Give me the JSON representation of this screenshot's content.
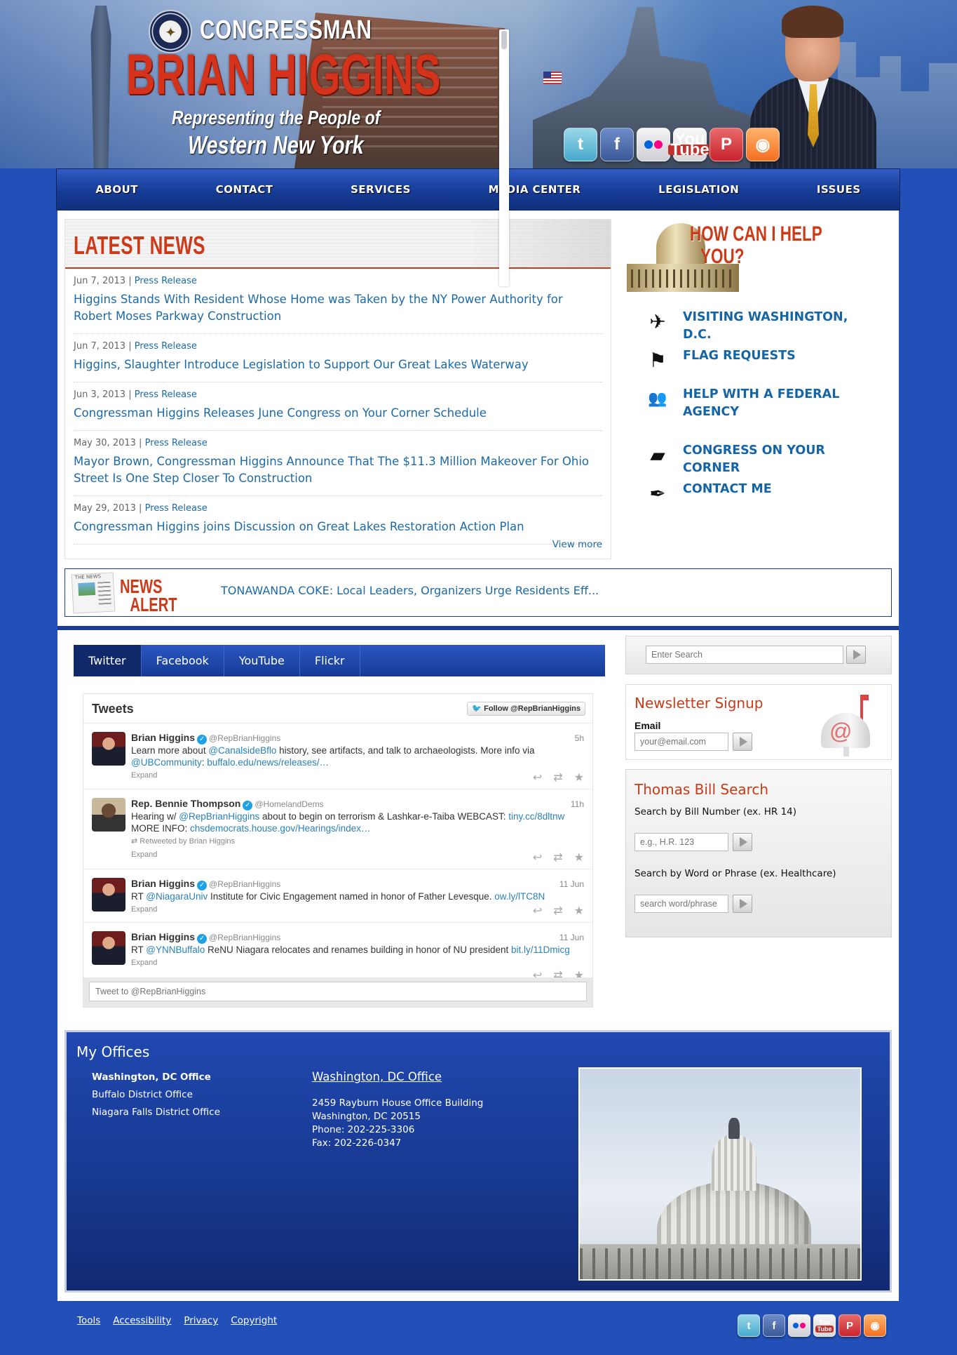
{
  "header": {
    "congressman": "CONGRESSMAN",
    "name": "BRIAN HIGGINS",
    "tagline_1": "Representing the People of",
    "tagline_2": "Western New York",
    "social": [
      "twitter-icon",
      "facebook-icon",
      "flickr-icon",
      "youtube-icon",
      "pinterest-icon",
      "rss-icon"
    ]
  },
  "nav": [
    "ABOUT",
    "CONTACT",
    "SERVICES",
    "MEDIA CENTER",
    "LEGISLATION",
    "ISSUES"
  ],
  "news": {
    "heading": "LATEST NEWS",
    "items": [
      {
        "date": "Jun 7, 2013",
        "sep": "|",
        "category": "Press Release",
        "title": "Higgins Stands With Resident Whose Home was Taken by the NY Power Authority for Robert Moses Parkway Construction"
      },
      {
        "date": "Jun 7, 2013",
        "sep": "|",
        "category": "Press Release",
        "title": "Higgins, Slaughter Introduce Legislation to Support Our Great Lakes Waterway"
      },
      {
        "date": "Jun 3, 2013",
        "sep": "|",
        "category": "Press Release",
        "title": "Congressman Higgins Releases June Congress on Your Corner Schedule"
      },
      {
        "date": "May 30, 2013",
        "sep": "|",
        "category": "Press Release",
        "title": "Mayor Brown, Congressman Higgins Announce That The $11.3 Million Makeover For Ohio Street Is One Step Closer To Construction"
      },
      {
        "date": "May 29, 2013",
        "sep": "|",
        "category": "Press Release",
        "title": "Congressman Higgins joins Discussion on Great Lakes Restoration Action Plan"
      }
    ],
    "view_more": "View more"
  },
  "help": {
    "title_1": "HOW CAN I HELP",
    "title_2": "YOU?",
    "items": [
      {
        "label": "VISITING WASHINGTON, D.C.",
        "icon": "airplane-icon",
        "glyph": "✈"
      },
      {
        "label": "FLAG REQUESTS",
        "icon": "flag-icon",
        "glyph": "⚑"
      },
      {
        "label": "HELP WITH A FEDERAL AGENCY",
        "icon": "people-icon",
        "glyph": "👥"
      },
      {
        "label": "CONGRESS ON YOUR CORNER",
        "icon": "usa-map-icon",
        "glyph": "▰"
      },
      {
        "label": "CONTACT ME",
        "icon": "pen-icon",
        "glyph": "✒"
      }
    ]
  },
  "alert": {
    "label_1": "NEWS",
    "label_2": "ALERT",
    "paper_text": "THE NEWS",
    "text": "TONAWANDA COKE: Local Leaders, Organizers Urge Residents Eff..."
  },
  "tabs": [
    "Twitter",
    "Facebook",
    "YouTube",
    "Flickr"
  ],
  "tweets": {
    "heading": "Tweets",
    "follow": "Follow @RepBrianHiggins",
    "items": [
      {
        "name": "Brian Higgins",
        "handle": "@RepBrianHiggins",
        "time": "5h",
        "text_1": "Learn more about ",
        "link_1": "@CanalsideBflo",
        "text_2": " history, see artifacts, and talk to archaeologists. More info via ",
        "link_2": "@UBCommunity",
        "text_3": ": ",
        "link_3": "buffalo.edu/news/releases/…",
        "retweet": "",
        "expand": "Expand"
      },
      {
        "name": "Rep. Bennie Thompson",
        "handle": "@HomelandDems",
        "time": "11h",
        "text_1": "Hearing w/ ",
        "link_1": "@RepBrianHiggins",
        "text_2": " about to begin on terrorism & Lashkar-e-Taiba WEBCAST: ",
        "link_2": "tiny.cc/8dltnw",
        "text_3": "  MORE INFO: ",
        "link_3": "chsdemocrats.house.gov/Hearings/index…",
        "retweet": "Retweeted by Brian Higgins",
        "expand": "Expand"
      },
      {
        "name": "Brian Higgins",
        "handle": "@RepBrianHiggins",
        "time": "11 Jun",
        "text_1": "RT ",
        "link_1": "@NiagaraUniv",
        "text_2": " Institute for Civic Engagement named in honor of Father Levesque. ",
        "link_2": "ow.ly/lTC8N",
        "text_3": "",
        "link_3": "",
        "retweet": "",
        "expand": "Expand"
      },
      {
        "name": "Brian Higgins",
        "handle": "@RepBrianHiggins",
        "time": "11 Jun",
        "text_1": "RT ",
        "link_1": "@YNNBuffalo",
        "text_2": " ReNU Niagara relocates and renames building in honor of NU president ",
        "link_2": "bit.ly/11Dmicg",
        "text_3": "",
        "link_3": "",
        "retweet": "",
        "expand": "Expand"
      }
    ],
    "compose_placeholder": "Tweet to @RepBrianHiggins"
  },
  "search": {
    "placeholder": "Enter Search"
  },
  "newsletter": {
    "title": "Newsletter Signup",
    "email_label": "Email",
    "placeholder": "your@email.com"
  },
  "thomas": {
    "title": "Thomas Bill Search",
    "label_number": "Search by Bill Number (ex. HR 14)",
    "placeholder_number": "e.g., H.R. 123",
    "label_word": "Search by Word or Phrase (ex. Healthcare)",
    "placeholder_word": "search word/phrase"
  },
  "offices": {
    "heading": "My Offices",
    "list": [
      "Washington, DC Office",
      "Buffalo District Office",
      "Niagara Falls District Office"
    ],
    "selected_title": "Washington, DC Office",
    "address": [
      "2459 Rayburn House Office Building",
      "Washington, DC 20515",
      "Phone: 202-225-3306",
      "Fax: 202-226-0347"
    ]
  },
  "footer": {
    "links": [
      "Tools",
      "Accessibility",
      "Privacy",
      "Copyright"
    ]
  }
}
